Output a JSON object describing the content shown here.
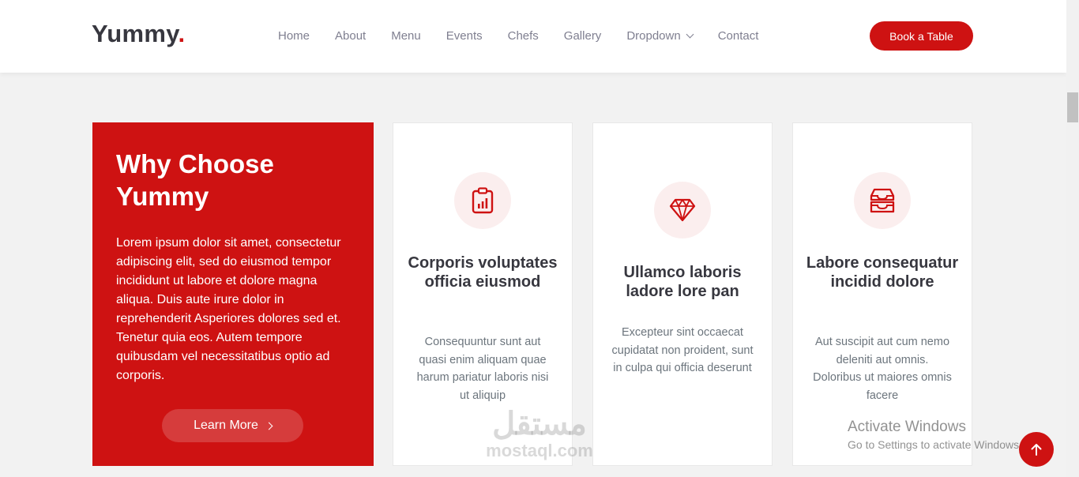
{
  "header": {
    "logo_text": "Yummy",
    "logo_dot": ".",
    "nav": [
      {
        "label": "Home"
      },
      {
        "label": "About"
      },
      {
        "label": "Menu"
      },
      {
        "label": "Events"
      },
      {
        "label": "Chefs"
      },
      {
        "label": "Gallery"
      },
      {
        "label": "Dropdown",
        "has_dropdown": true
      },
      {
        "label": "Contact"
      }
    ],
    "cta_label": "Book a Table"
  },
  "why_us": {
    "title": "Why Choose Yummy",
    "text": "Lorem ipsum dolor sit amet, consectetur adipiscing elit, sed do eiusmod tempor incididunt ut labore et dolore magna aliqua. Duis aute irure dolor in reprehenderit Asperiores dolores sed et. Tenetur quia eos. Autem tempore quibusdam vel necessitatibus optio ad corporis.",
    "button_label": "Learn More"
  },
  "cards": [
    {
      "icon": "clipboard-data-icon",
      "title": "Corporis voluptates officia eiusmod",
      "text": "Consequuntur sunt aut quasi enim aliquam quae harum pariatur laboris nisi ut aliquip"
    },
    {
      "icon": "gem-icon",
      "title": "Ullamco laboris ladore lore pan",
      "text": "Excepteur sint occaecat cupidatat non proident, sunt in culpa qui officia deserunt"
    },
    {
      "icon": "inboxes-icon",
      "title": "Labore consequatur incidid dolore",
      "text": "Aut suscipit aut cum nemo deleniti aut omnis. Doloribus ut maiores omnis facere"
    }
  ],
  "watermark": {
    "arabic": "مستقل",
    "latin": "mostaql.com"
  },
  "windows_notice": {
    "line1": "Activate Windows",
    "line2": "Go to Settings to activate Windows."
  },
  "scroll_top_icon": "arrow-up-icon",
  "colors": {
    "accent": "#ce1212",
    "background": "#f2f2f2",
    "text": "#37373f",
    "nav_text": "#7f7f90"
  }
}
